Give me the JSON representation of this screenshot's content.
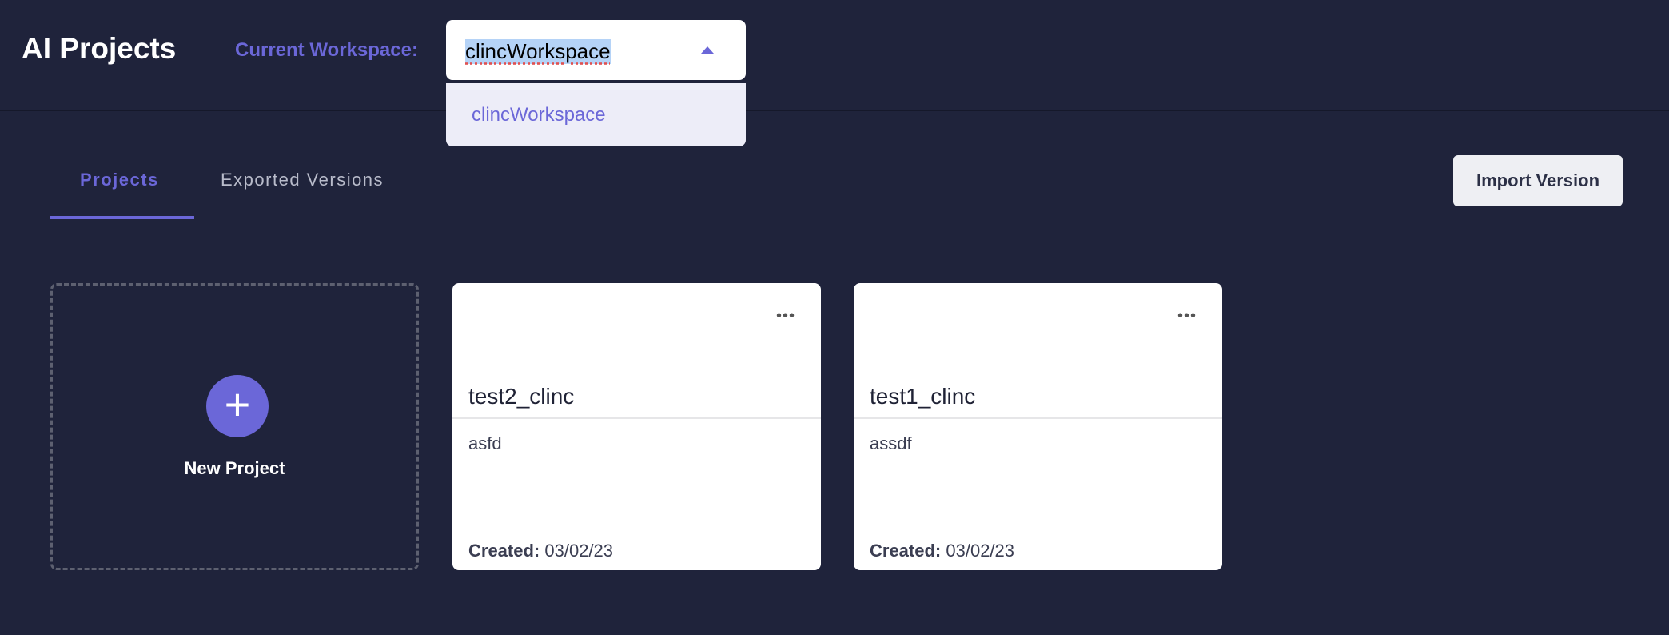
{
  "header": {
    "title": "AI Projects",
    "workspace_label": "Current Workspace:",
    "workspace_value": "clincWorkspace",
    "dropdown_options": [
      "clincWorkspace"
    ]
  },
  "tabs": [
    {
      "label": "Projects",
      "active": true
    },
    {
      "label": "Exported Versions",
      "active": false
    }
  ],
  "import_button": "Import Version",
  "new_project": {
    "icon": "plus-icon",
    "label": "New Project"
  },
  "projects": [
    {
      "name": "test2_clinc",
      "description": "asfd",
      "created_label": "Created:",
      "created": "03/02/23"
    },
    {
      "name": "test1_clinc",
      "description": "assdf",
      "created_label": "Created:",
      "created": "03/02/23"
    }
  ],
  "colors": {
    "background": "#1f233b",
    "accent": "#6b67d8"
  }
}
